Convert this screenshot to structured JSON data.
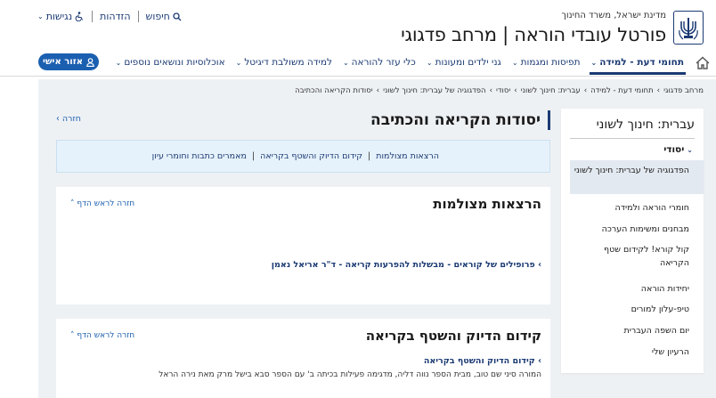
{
  "header": {
    "gov_line": "מדינת ישראל, משרד החינוך",
    "portal_title": "פורטל עובדי הוראה | מרחב פדגוגי",
    "util": {
      "search": "חיפוש",
      "login": "הזדהות",
      "accessibility": "נגישות"
    }
  },
  "nav": {
    "items": [
      {
        "label": "תחומי דעת - למידה",
        "active": true
      },
      {
        "label": "תפיסות ומגמות",
        "active": false
      },
      {
        "label": "גני ילדים ומעונות",
        "active": false
      },
      {
        "label": "כלי עזר להוראה",
        "active": false
      },
      {
        "label": "למידה משולבת דיגיטל",
        "active": false
      },
      {
        "label": "אוכלוסיות ונושאים נוספים",
        "active": false
      }
    ],
    "personal_area": "אזור אישי"
  },
  "breadcrumb": [
    "מרחב פדגוגי",
    "תחומי דעת - למידה",
    "עברית: חינוך לשוני",
    "יסודי",
    "הפדגוגיה של עברית: חינוך לשוני",
    "יסודות הקריאה והכתיבה"
  ],
  "sidebar": {
    "title": "עברית: חינוך לשוני",
    "sub": "יסודי",
    "items": [
      "הפדגוגיה של עברית: חינוך לשוני",
      "חומרי הוראה ולמידה",
      "מבחנים ומשימות הערכה",
      "קול קורא! לקידום שטף הקריאה",
      "יחידות הוראה",
      "טיפ-עלון למורים",
      "יום השפה העברית",
      "הרעיון שלי"
    ]
  },
  "page": {
    "title": "יסודות הקריאה והכתיבה",
    "back": "חזרה",
    "anchors": [
      "הרצאות מצולמות",
      "קידום הדיוק והשטף בקריאה",
      "מאמרים כתבות וחומרי עיון"
    ]
  },
  "sections": {
    "lectures": {
      "title": "הרצאות מצולמות",
      "to_top": "חזרה לראש הדף",
      "link": "פרופילים של קוראים - מבשלות להפרעות קריאה - ד\"ר אריאל נאמן"
    },
    "fluency": {
      "title": "קידום הדיוק והשטף בקריאה",
      "to_top": "חזרה לראש הדף",
      "link": "קידום הדיוק והשטף בקריאה",
      "text": "המורה סיני שם טוב, מבית הספר נווה דליה, מדגימה פעילות בכיתה ב' עם הספר סבא בישל מרק מאת נירה הראל"
    }
  }
}
